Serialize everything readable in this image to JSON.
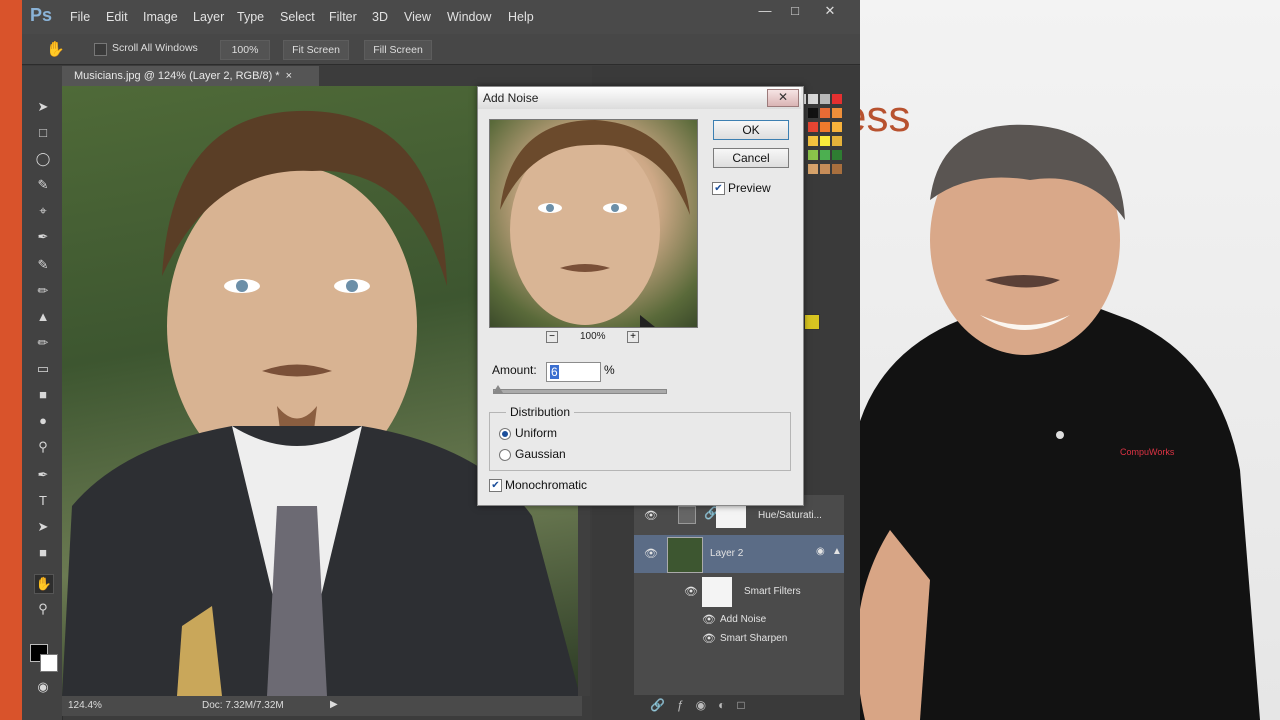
{
  "app": {
    "logo": "Ps",
    "menu": [
      "File",
      "Edit",
      "Image",
      "Layer",
      "Type",
      "Select",
      "Filter",
      "3D",
      "View",
      "Window",
      "Help"
    ]
  },
  "options_bar": {
    "scroll_all_windows": "Scroll All Windows",
    "zoom_btn": "100%",
    "fit_screen": "Fit Screen",
    "fill_screen": "Fill Screen"
  },
  "document": {
    "tab_title": "Musicians.jpg @ 124% (Layer 2, RGB/8) *",
    "zoom": "124.4%",
    "doc_size": "Doc: 7.32M/7.32M"
  },
  "dialog": {
    "title": "Add Noise",
    "ok": "OK",
    "cancel": "Cancel",
    "preview_label": "Preview",
    "preview_zoom": "100%",
    "amount_label": "Amount:",
    "amount_value": "6",
    "amount_unit": "%",
    "amount_level": 0.03,
    "distribution_label": "Distribution",
    "uniform": "Uniform",
    "gaussian": "Gaussian",
    "monochromatic": "Monochromatic",
    "preview_checked": true,
    "monochromatic_checked": true,
    "selected_distribution": "Uniform"
  },
  "layers": {
    "hue_sat": "Hue/Saturati...",
    "layer2": "Layer 2",
    "smart_filters": "Smart Filters",
    "filters": [
      "Add Noise",
      "Smart Sharpen"
    ]
  },
  "slide": {
    "text": "ess"
  },
  "colors": {
    "accent": "#d9532b",
    "swatches": [
      "#f7f7f7",
      "#d8d8d8",
      "#b8b8b8",
      "#e53030",
      "#111111",
      "#e86b35",
      "#ef8f3a",
      "#f7b23b",
      "#e64532",
      "#ef7a2c",
      "#f4c33f",
      "#f9ea3b",
      "#e6b23a",
      "#8bc34a",
      "#4caf50",
      "#2e7d32",
      "#d7a36b",
      "#c68c58",
      "#a86f3e"
    ]
  }
}
